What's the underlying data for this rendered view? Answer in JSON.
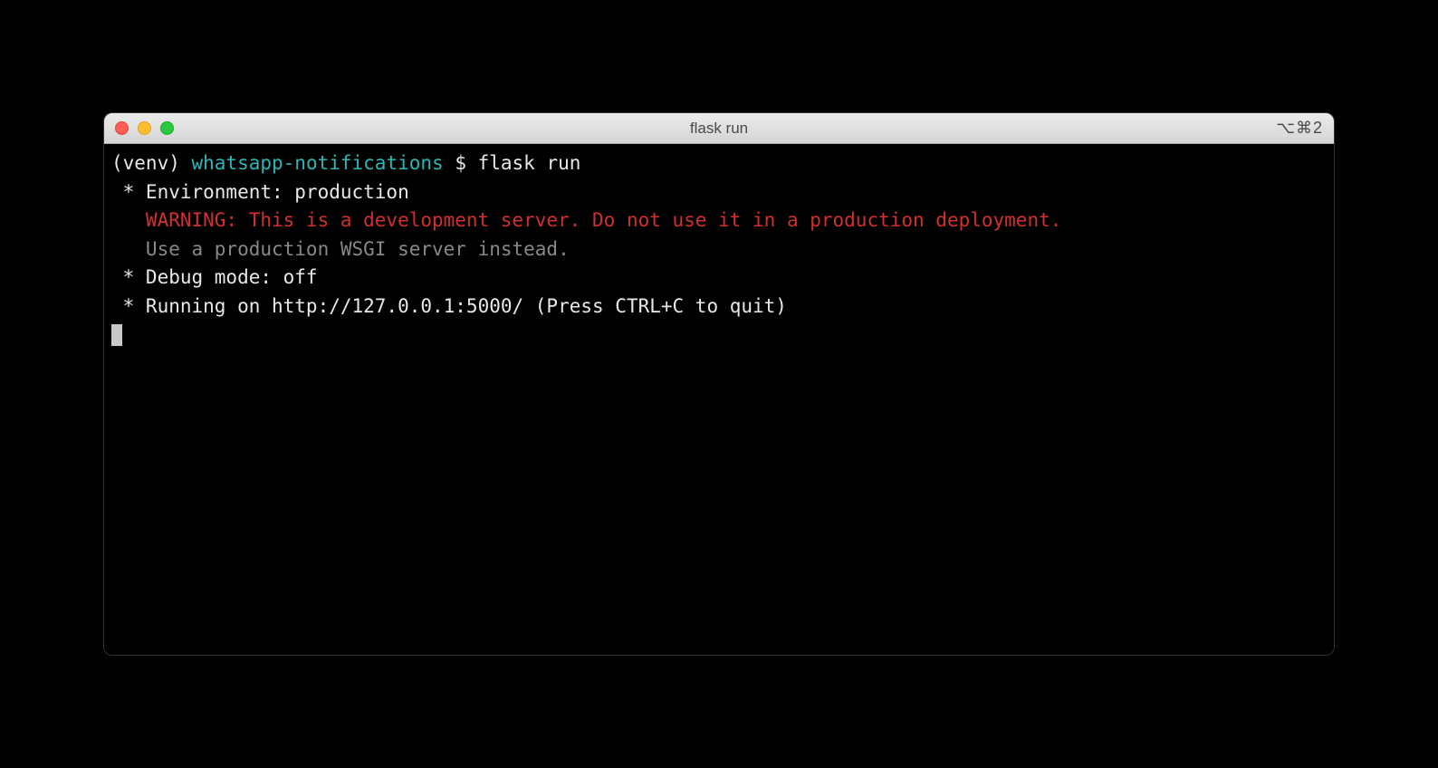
{
  "window": {
    "title": "flask run",
    "shortcut": "⌥⌘2"
  },
  "prompt": {
    "env": "(venv) ",
    "path": "whatsapp-notifications",
    "sep": " $ ",
    "command": "flask run"
  },
  "output": {
    "env_line": " * Environment: production",
    "warning": "   WARNING: This is a development server. Do not use it in a production deployment.",
    "wsgi_hint": "   Use a production WSGI server instead.",
    "debug_line": " * Debug mode: off",
    "running_line": " * Running on http://127.0.0.1:5000/ (Press CTRL+C to quit)"
  }
}
